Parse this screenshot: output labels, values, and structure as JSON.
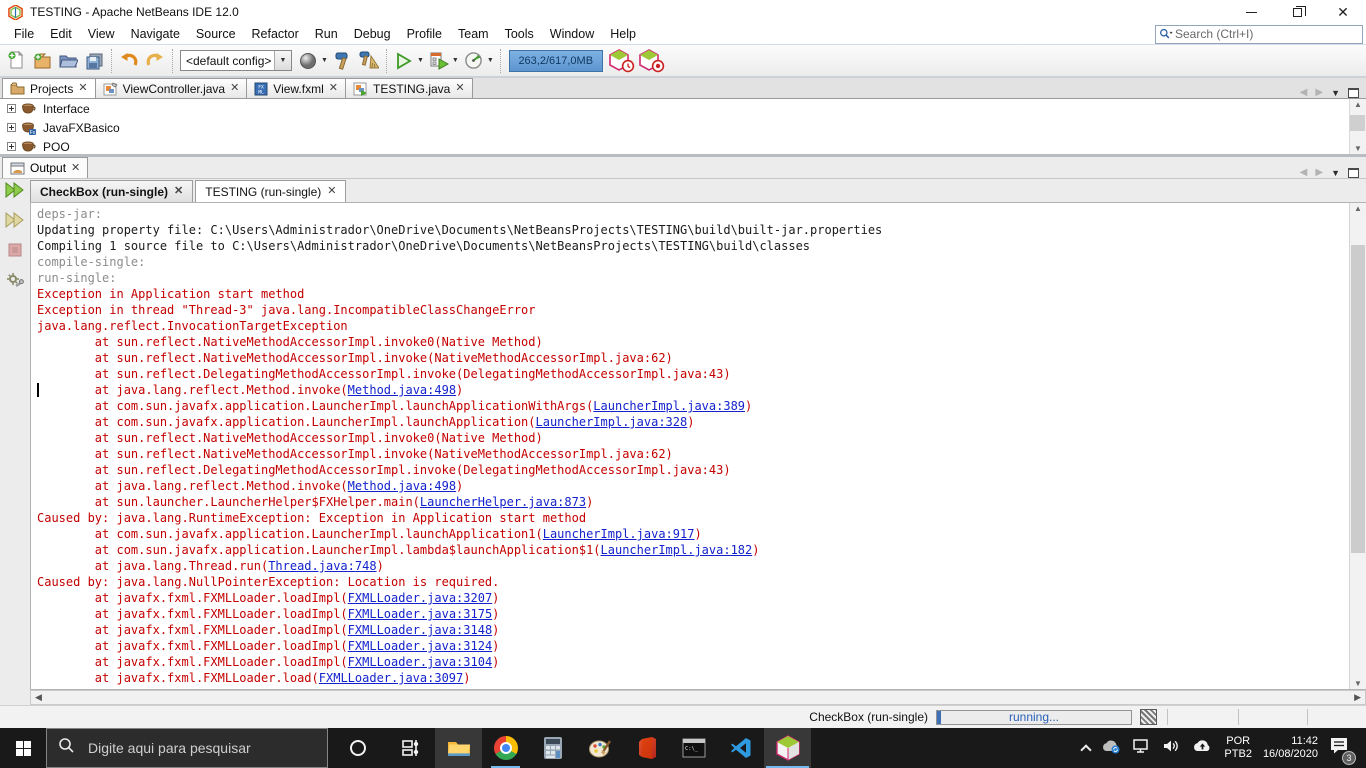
{
  "window": {
    "title": "TESTING - Apache NetBeans IDE 12.0"
  },
  "menu": {
    "items": [
      "File",
      "Edit",
      "View",
      "Navigate",
      "Source",
      "Refactor",
      "Run",
      "Debug",
      "Profile",
      "Team",
      "Tools",
      "Window",
      "Help"
    ],
    "search_placeholder": "Search (Ctrl+I)"
  },
  "toolbar": {
    "config_value": "<default config>",
    "memory": "263,2/617,0MB"
  },
  "tabs": {
    "projects_label": "Projects",
    "editors": [
      "ViewController.java",
      "View.fxml",
      "TESTING.java"
    ]
  },
  "projects": {
    "items": [
      "Interface",
      "JavaFXBasico",
      "POO"
    ]
  },
  "output": {
    "panel_tab": "Output",
    "tabs": [
      {
        "label": "CheckBox (run-single)"
      },
      {
        "label": "TESTING (run-single)"
      }
    ],
    "lines": [
      {
        "parts": [
          {
            "c": "target",
            "t": "deps-jar:"
          }
        ]
      },
      {
        "parts": [
          {
            "c": "plain",
            "t": "Updating property file: C:\\Users\\Administrador\\OneDrive\\Documents\\NetBeansProjects\\TESTING\\build\\built-jar.properties"
          }
        ]
      },
      {
        "parts": [
          {
            "c": "plain",
            "t": "Compiling 1 source file to C:\\Users\\Administrador\\OneDrive\\Documents\\NetBeansProjects\\TESTING\\build\\classes"
          }
        ]
      },
      {
        "parts": [
          {
            "c": "target",
            "t": "compile-single:"
          }
        ]
      },
      {
        "parts": [
          {
            "c": "target",
            "t": "run-single:"
          }
        ]
      },
      {
        "parts": [
          {
            "c": "err",
            "t": "Exception in Application start method"
          }
        ]
      },
      {
        "parts": [
          {
            "c": "err",
            "t": "Exception in thread \"Thread-3\" java.lang.IncompatibleClassChangeError"
          }
        ]
      },
      {
        "parts": [
          {
            "c": "err",
            "t": "java.lang.reflect.InvocationTargetException"
          }
        ]
      },
      {
        "parts": [
          {
            "c": "err",
            "t": "        at sun.reflect.NativeMethodAccessorImpl.invoke0(Native Method)"
          }
        ]
      },
      {
        "parts": [
          {
            "c": "err",
            "t": "        at sun.reflect.NativeMethodAccessorImpl.invoke(NativeMethodAccessorImpl.java:62)"
          }
        ]
      },
      {
        "parts": [
          {
            "c": "err",
            "t": "        at sun.reflect.DelegatingMethodAccessorImpl.invoke(DelegatingMethodAccessorImpl.java:43)"
          }
        ]
      },
      {
        "parts": [
          {
            "c": "err",
            "t": "        at java.lang.reflect.Method.invoke("
          },
          {
            "c": "link",
            "t": "Method.java:498"
          },
          {
            "c": "err",
            "t": ")"
          }
        ]
      },
      {
        "parts": [
          {
            "c": "err",
            "t": "        at com.sun.javafx.application.LauncherImpl.launchApplicationWithArgs("
          },
          {
            "c": "link",
            "t": "LauncherImpl.java:389"
          },
          {
            "c": "err",
            "t": ")"
          }
        ]
      },
      {
        "parts": [
          {
            "c": "err",
            "t": "        at com.sun.javafx.application.LauncherImpl.launchApplication("
          },
          {
            "c": "link",
            "t": "LauncherImpl.java:328"
          },
          {
            "c": "err",
            "t": ")"
          }
        ]
      },
      {
        "parts": [
          {
            "c": "err",
            "t": "        at sun.reflect.NativeMethodAccessorImpl.invoke0(Native Method)"
          }
        ]
      },
      {
        "parts": [
          {
            "c": "err",
            "t": "        at sun.reflect.NativeMethodAccessorImpl.invoke(NativeMethodAccessorImpl.java:62)"
          }
        ]
      },
      {
        "parts": [
          {
            "c": "err",
            "t": "        at sun.reflect.DelegatingMethodAccessorImpl.invoke(DelegatingMethodAccessorImpl.java:43)"
          }
        ]
      },
      {
        "parts": [
          {
            "c": "err",
            "t": "        at java.lang.reflect.Method.invoke("
          },
          {
            "c": "link",
            "t": "Method.java:498"
          },
          {
            "c": "err",
            "t": ")"
          }
        ]
      },
      {
        "parts": [
          {
            "c": "err",
            "t": "        at sun.launcher.LauncherHelper$FXHelper.main("
          },
          {
            "c": "link",
            "t": "LauncherHelper.java:873"
          },
          {
            "c": "err",
            "t": ")"
          }
        ]
      },
      {
        "parts": [
          {
            "c": "err",
            "t": "Caused by: java.lang.RuntimeException: Exception in Application start method"
          }
        ]
      },
      {
        "parts": [
          {
            "c": "err",
            "t": "        at com.sun.javafx.application.LauncherImpl.launchApplication1("
          },
          {
            "c": "link",
            "t": "LauncherImpl.java:917"
          },
          {
            "c": "err",
            "t": ")"
          }
        ]
      },
      {
        "parts": [
          {
            "c": "err",
            "t": "        at com.sun.javafx.application.LauncherImpl.lambda$launchApplication$1("
          },
          {
            "c": "link",
            "t": "LauncherImpl.java:182"
          },
          {
            "c": "err",
            "t": ")"
          }
        ]
      },
      {
        "parts": [
          {
            "c": "err",
            "t": "        at java.lang.Thread.run("
          },
          {
            "c": "link",
            "t": "Thread.java:748"
          },
          {
            "c": "err",
            "t": ")"
          }
        ]
      },
      {
        "parts": [
          {
            "c": "err",
            "t": "Caused by: java.lang.NullPointerException: Location is required."
          }
        ]
      },
      {
        "parts": [
          {
            "c": "err",
            "t": "        at javafx.fxml.FXMLLoader.loadImpl("
          },
          {
            "c": "link",
            "t": "FXMLLoader.java:3207"
          },
          {
            "c": "err",
            "t": ")"
          }
        ]
      },
      {
        "parts": [
          {
            "c": "err",
            "t": "        at javafx.fxml.FXMLLoader.loadImpl("
          },
          {
            "c": "link",
            "t": "FXMLLoader.java:3175"
          },
          {
            "c": "err",
            "t": ")"
          }
        ]
      },
      {
        "parts": [
          {
            "c": "err",
            "t": "        at javafx.fxml.FXMLLoader.loadImpl("
          },
          {
            "c": "link",
            "t": "FXMLLoader.java:3148"
          },
          {
            "c": "err",
            "t": ")"
          }
        ]
      },
      {
        "parts": [
          {
            "c": "err",
            "t": "        at javafx.fxml.FXMLLoader.loadImpl("
          },
          {
            "c": "link",
            "t": "FXMLLoader.java:3124"
          },
          {
            "c": "err",
            "t": ")"
          }
        ]
      },
      {
        "parts": [
          {
            "c": "err",
            "t": "        at javafx.fxml.FXMLLoader.loadImpl("
          },
          {
            "c": "link",
            "t": "FXMLLoader.java:3104"
          },
          {
            "c": "err",
            "t": ")"
          }
        ]
      },
      {
        "parts": [
          {
            "c": "err",
            "t": "        at javafx.fxml.FXMLLoader.load("
          },
          {
            "c": "link",
            "t": "FXMLLoader.java:3097"
          },
          {
            "c": "err",
            "t": ")"
          }
        ]
      }
    ]
  },
  "statusbar": {
    "task_label": "CheckBox (run-single)",
    "progress_text": "running..."
  },
  "taskbar": {
    "search_placeholder": "Digite aqui para pesquisar",
    "lang_line1": "POR",
    "lang_line2": "PTB2",
    "time": "11:42",
    "date": "16/08/2020",
    "notification_count": "3"
  }
}
